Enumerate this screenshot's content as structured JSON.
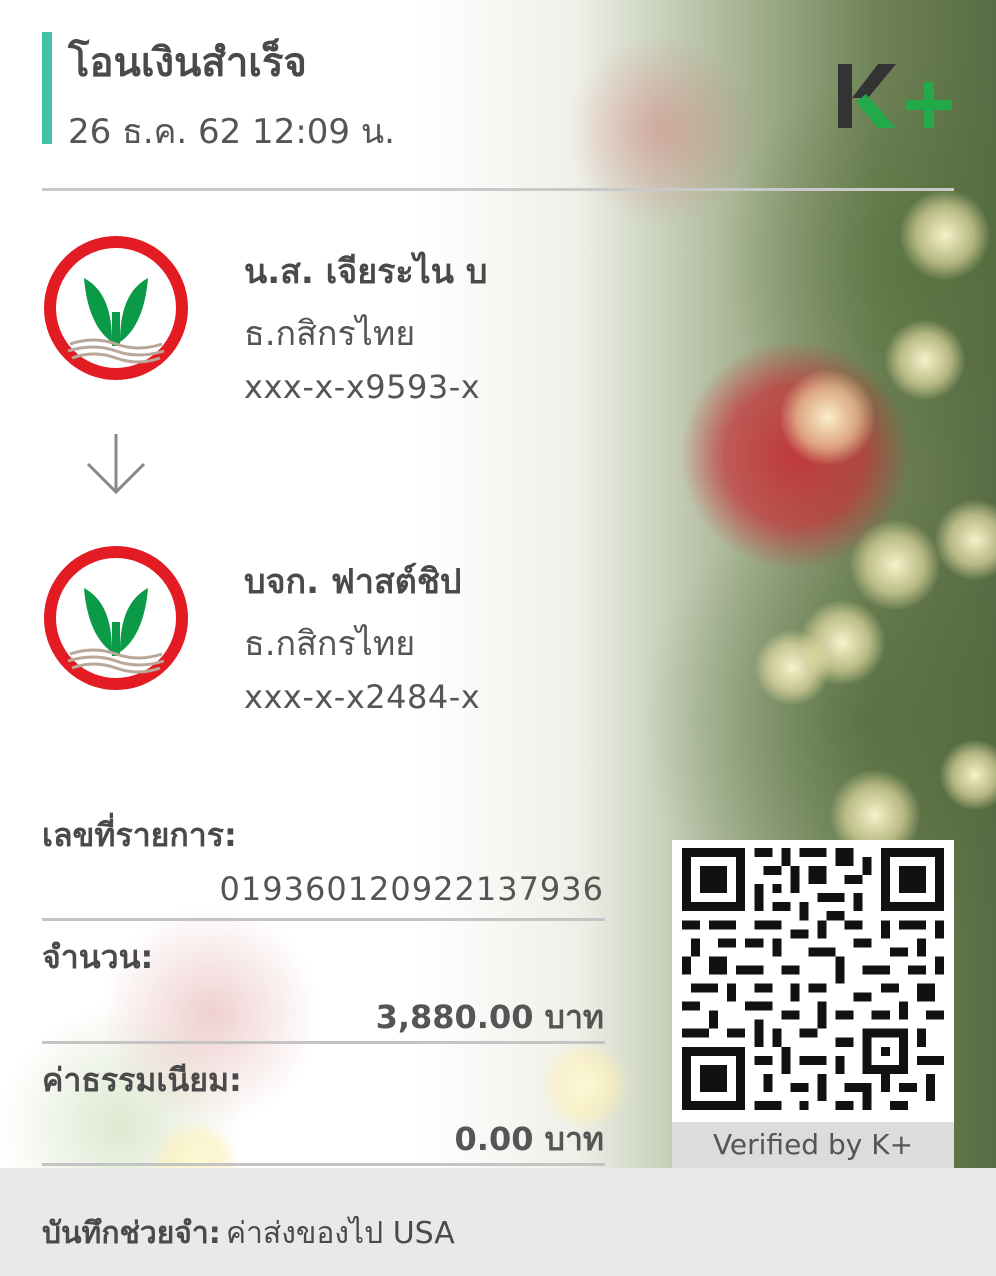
{
  "header": {
    "title": "โอนเงินสำเร็จ",
    "datetime": "26 ธ.ค. 62  12:09 น.",
    "logo_text": "K+"
  },
  "sender": {
    "name": "น.ส. เจียระไน บ",
    "bank": "ธ.กสิกรไทย",
    "account": "xxx-x-x9593-x"
  },
  "receiver": {
    "name": "บจก. ฟาสต์ชิป",
    "bank": "ธ.กสิกรไทย",
    "account": "xxx-x-x2484-x"
  },
  "details": {
    "ref_label": "เลขที่รายการ:",
    "ref_value": "019360120922137936",
    "amount_label": "จำนวน:",
    "amount_value": "3,880.00 บาท",
    "fee_label": "ค่าธรรมเนียม:",
    "fee_value": "0.00 บาท"
  },
  "qr": {
    "caption": "Verified by K+"
  },
  "memo": {
    "label": "บันทึกช่วยจำ:",
    "value": "ค่าส่งของไป USA"
  },
  "colors": {
    "accent_teal": "#43c2a8",
    "kbank_green": "#0a9a48",
    "kbank_red": "#e31b23",
    "logo_dark": "#333333",
    "logo_green": "#22a94a"
  }
}
